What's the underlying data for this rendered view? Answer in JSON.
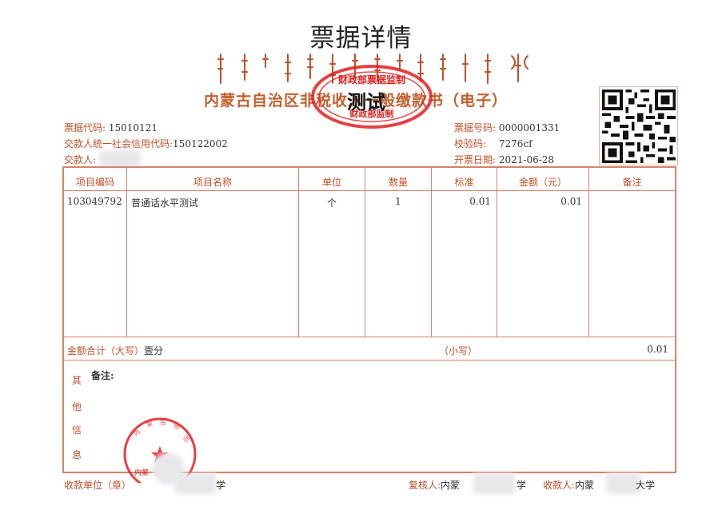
{
  "page_title": "票据详情",
  "receipt": {
    "title": "内蒙古自治区非税收入一般缴款书（电子）",
    "test_mark": "测试",
    "seal": {
      "line1": "财政部票据监制",
      "line2": "财政部监制"
    }
  },
  "meta_left": {
    "code_label": "票据代码:",
    "code_value": "15010121",
    "credit_label": "交款人统一社会信用代码:",
    "credit_value": "150122002",
    "payer_label": "交款人:"
  },
  "meta_right": {
    "number_label": "票据号码:",
    "number_value": "0000001331",
    "check_label": "校验码:",
    "check_value": "7276cf",
    "date_label": "开票日期:",
    "date_value": "2021-06-28"
  },
  "table": {
    "headers": [
      "项目编码",
      "项目名称",
      "单位",
      "数量",
      "标准",
      "金额（元）",
      "备注"
    ],
    "rows": [
      [
        "103049792",
        "普通话水平测试",
        "个",
        "1",
        "0.01",
        "0.01",
        ""
      ]
    ]
  },
  "totals": {
    "upper_label": "金额合计（大写）",
    "upper_value": "壹分",
    "lower_label": "（小写）",
    "lower_value": "0.01"
  },
  "other": {
    "side_chars": [
      "其",
      "他",
      "信",
      "息"
    ],
    "remark_label": "备注:"
  },
  "footer": {
    "unit_label": "收款单位（章）",
    "unit_suffix": "学",
    "reviewer_label": "复核人:",
    "reviewer_prefix": "内蒙",
    "reviewer_suffix": "学",
    "payee_label": "收款人:",
    "payee_prefix": "内蒙",
    "payee_suffix": "大学"
  },
  "stamp_text": "内蒙"
}
